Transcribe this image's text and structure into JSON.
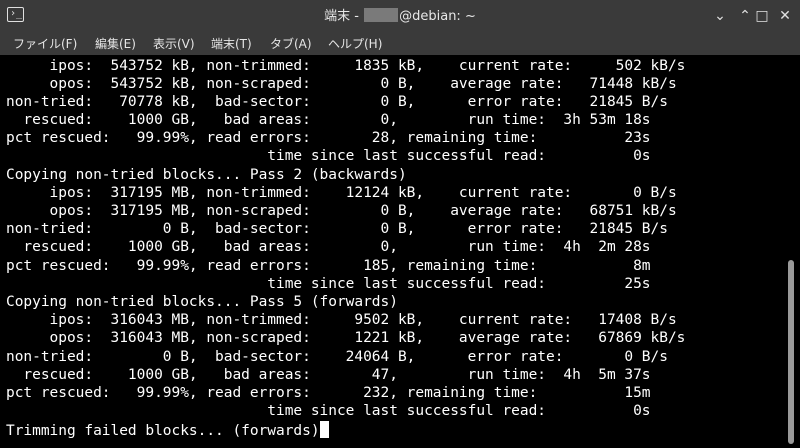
{
  "window": {
    "app_icon_glyph": "›_",
    "title_prefix": "端末 - ",
    "title_suffix": "@debian: ~",
    "buttons": {
      "minimize": "⌄",
      "restore": "⌃",
      "maximize": "□",
      "close": "✕"
    }
  },
  "menu": {
    "items": [
      "ファイル(F)",
      "編集(E)",
      "表示(V)",
      "端末(T)",
      "タブ(A)",
      "ヘルプ(H)"
    ]
  },
  "terminal": {
    "lines": [
      "     ipos:  543752 kB, non-trimmed:     1835 kB,    current rate:     502 kB/s",
      "     opos:  543752 kB, non-scraped:        0 B,    average rate:   71448 kB/s",
      "non-tried:   70778 kB,  bad-sector:        0 B,      error rate:   21845 B/s",
      "  rescued:    1000 GB,   bad areas:        0,        run time:  3h 53m 18s",
      "pct rescued:   99.99%, read errors:       28, remaining time:          23s",
      "                              time since last successful read:          0s",
      "Copying non-tried blocks... Pass 2 (backwards)",
      "     ipos:  317195 MB, non-trimmed:    12124 kB,    current rate:       0 B/s",
      "     opos:  317195 MB, non-scraped:        0 B,    average rate:   68751 kB/s",
      "non-tried:        0 B,  bad-sector:        0 B,      error rate:   21845 B/s",
      "  rescued:    1000 GB,   bad areas:        0,        run time:  4h  2m 28s",
      "pct rescued:   99.99%, read errors:      185, remaining time:           8m",
      "                              time since last successful read:         25s",
      "Copying non-tried blocks... Pass 5 (forwards)",
      "     ipos:  316043 MB, non-trimmed:     9502 kB,    current rate:   17408 B/s",
      "     opos:  316043 MB, non-scraped:     1221 kB,    average rate:   67869 kB/s",
      "non-tried:        0 B,  bad-sector:    24064 B,      error rate:       0 B/s",
      "  rescued:    1000 GB,   bad areas:       47,        run time:  4h  5m 37s",
      "pct rescued:   99.99%, read errors:      232, remaining time:          15m",
      "                              time since last successful read:          0s",
      "Trimming failed blocks... (forwards)"
    ]
  }
}
